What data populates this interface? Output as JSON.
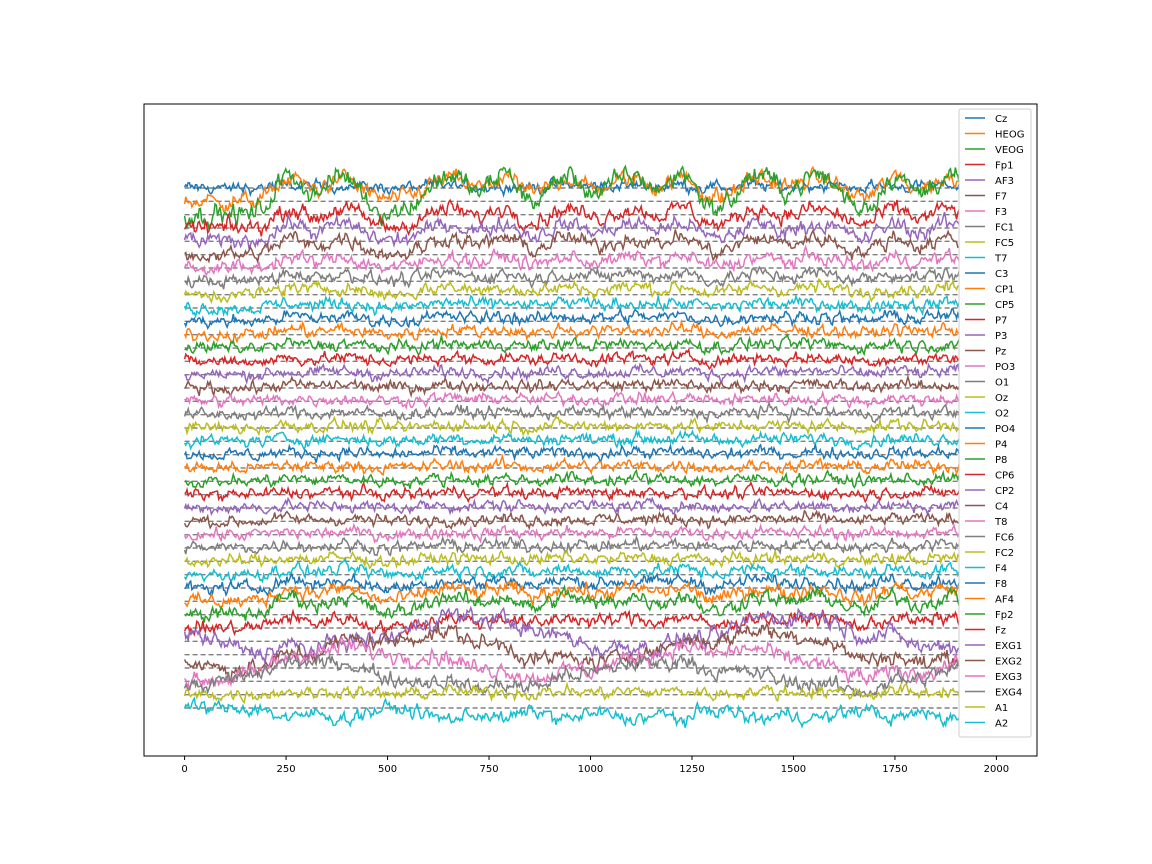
{
  "chart_data": {
    "type": "line",
    "title": "",
    "xlabel": "",
    "ylabel": "",
    "xlim": [
      -100,
      2100
    ],
    "xticks": [
      0,
      250,
      500,
      750,
      1000,
      1250,
      1500,
      1750,
      2000
    ],
    "x_range": [
      0,
      1910
    ],
    "grid": false,
    "legend_position": "top-right",
    "y_axis_labels": false,
    "baseline_style": "dashed-gray",
    "palette": [
      "#1f77b4",
      "#ff7f0e",
      "#2ca02c",
      "#d62728",
      "#9467bd",
      "#8c564b",
      "#e377c2",
      "#7f7f7f",
      "#bcbd22",
      "#17becf"
    ],
    "event_samples": [
      260,
      390,
      650,
      790,
      940,
      1100,
      1230,
      1410,
      1560,
      1750,
      1880
    ],
    "series": [
      {
        "name": "Cz",
        "amplitude": 0.3
      },
      {
        "name": "HEOG",
        "amplitude": 2.6
      },
      {
        "name": "VEOG",
        "amplitude": 4.5
      },
      {
        "name": "Fp1",
        "amplitude": 2.2
      },
      {
        "name": "AF3",
        "amplitude": 2.0
      },
      {
        "name": "F7",
        "amplitude": 1.9
      },
      {
        "name": "F3",
        "amplitude": 1.2
      },
      {
        "name": "FC1",
        "amplitude": 0.9
      },
      {
        "name": "FC5",
        "amplitude": 0.9
      },
      {
        "name": "T7",
        "amplitude": 0.6
      },
      {
        "name": "C3",
        "amplitude": 0.6
      },
      {
        "name": "CP1",
        "amplitude": 0.6
      },
      {
        "name": "CP5",
        "amplitude": 0.5
      },
      {
        "name": "P7",
        "amplitude": 0.4
      },
      {
        "name": "P3",
        "amplitude": 0.4
      },
      {
        "name": "Pz",
        "amplitude": 0.4
      },
      {
        "name": "PO3",
        "amplitude": 0.35
      },
      {
        "name": "O1",
        "amplitude": 0.35
      },
      {
        "name": "Oz",
        "amplitude": 0.35
      },
      {
        "name": "O2",
        "amplitude": 0.35
      },
      {
        "name": "PO4",
        "amplitude": 0.3
      },
      {
        "name": "P4",
        "amplitude": 0.3
      },
      {
        "name": "P8",
        "amplitude": 0.3
      },
      {
        "name": "CP6",
        "amplitude": 0.3
      },
      {
        "name": "CP2",
        "amplitude": 0.3
      },
      {
        "name": "C4",
        "amplitude": 0.3
      },
      {
        "name": "T8",
        "amplitude": 0.3
      },
      {
        "name": "FC6",
        "amplitude": 0.4
      },
      {
        "name": "FC2",
        "amplitude": 0.4
      },
      {
        "name": "F4",
        "amplitude": 0.6
      },
      {
        "name": "F8",
        "amplitude": 0.9
      },
      {
        "name": "AF4",
        "amplitude": 1.5
      },
      {
        "name": "Fp2",
        "amplitude": 2.1
      },
      {
        "name": "Fz",
        "amplitude": 1.2
      },
      {
        "name": "EXG1",
        "amplitude": 2.6
      },
      {
        "name": "EXG2",
        "amplitude": 2.4
      },
      {
        "name": "EXG3",
        "amplitude": 2.2
      },
      {
        "name": "EXG4",
        "amplitude": 2.0
      },
      {
        "name": "A1",
        "amplitude": 0.4
      },
      {
        "name": "A2",
        "amplitude": -1.2
      }
    ]
  }
}
